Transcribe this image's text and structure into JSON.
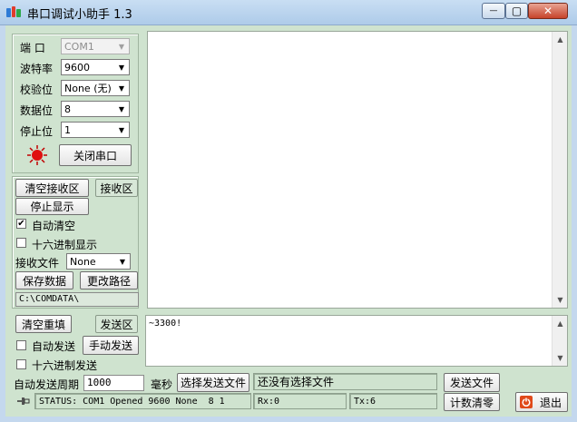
{
  "window": {
    "title": "串口调试小助手 1.3",
    "minimize_glyph": "—",
    "maximize_glyph": "▢",
    "close_glyph": "✕"
  },
  "port_settings": {
    "port_label": "端  口",
    "port_value": "COM1",
    "baud_label": "波特率",
    "baud_value": "9600",
    "parity_label": "校验位",
    "parity_value": "None (无)",
    "databits_label": "数据位",
    "databits_value": "8",
    "stopbits_label": "停止位",
    "stopbits_value": "1",
    "indicator_color": "#e01010",
    "close_port_label": "关闭串口"
  },
  "receive": {
    "clear_label": "清空接收区",
    "area_label": "接收区",
    "stop_display_label": "停止显示",
    "auto_clear_label": "自动清空",
    "auto_clear_checked": true,
    "hex_display_label": "十六进制显示",
    "hex_display_checked": false,
    "file_label": "接收文件",
    "file_value": "None",
    "save_data_label": "保存数据",
    "change_path_label": "更改路径",
    "path_value": "C:\\COMDATA\\",
    "content": ""
  },
  "send": {
    "clear_label": "清空重填",
    "area_label": "发送区",
    "auto_send_label": "自动发送",
    "auto_send_checked": false,
    "manual_send_label": "手动发送",
    "hex_send_label": "十六进制发送",
    "hex_send_checked": false,
    "period_label": "自动发送周期",
    "period_value": "1000",
    "ms_label": "毫秒",
    "choose_file_label": "选择发送文件",
    "file_status": "还没有选择文件",
    "send_file_label": "发送文件",
    "content": "~3300!"
  },
  "status": {
    "text": "STATUS: COM1 Opened 9600 None  8 1",
    "rx": "Rx:0",
    "tx": "Tx:6",
    "reset_count_label": "计数清零",
    "exit_label": "退出"
  }
}
